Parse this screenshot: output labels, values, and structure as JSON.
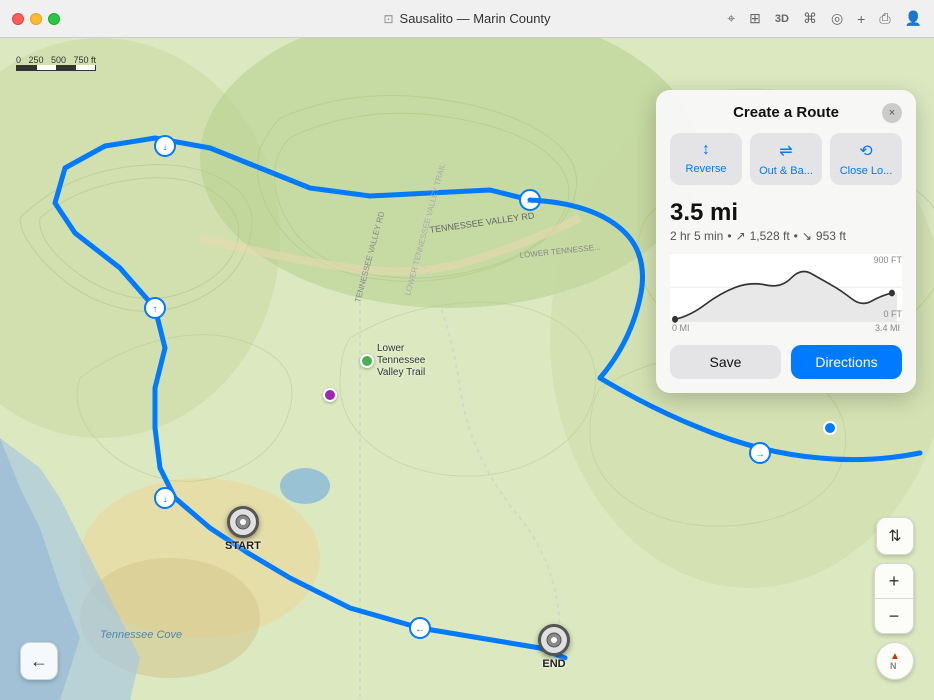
{
  "titleBar": {
    "title": "Sausalito — Marin County",
    "icons": [
      "location-arrow-icon",
      "layers-icon",
      "3d-icon",
      "transit-icon",
      "location-icon",
      "add-icon",
      "share-icon",
      "account-icon"
    ]
  },
  "scale": {
    "labels": [
      "0",
      "250",
      "500",
      "750 ft"
    ]
  },
  "panel": {
    "title": "Create a Route",
    "close_label": "×",
    "actions": [
      {
        "icon": "↕",
        "label": "Reverse"
      },
      {
        "icon": "S",
        "label": "Out & Ba..."
      },
      {
        "icon": "⟲",
        "label": "Close Lo..."
      }
    ],
    "route": {
      "distance": "3.5 mi",
      "time": "2 hr 5 min",
      "elevation_up": "1,528 ft",
      "elevation_down": "953 ft"
    },
    "elevationChart": {
      "yMax": "900 FT",
      "yMin": "0 FT",
      "xMin": "0 MI",
      "xMax": "3.4 MI"
    },
    "saveLabel": "Save",
    "directionsLabel": "Directions"
  },
  "markers": {
    "start": "START",
    "end": "END"
  },
  "mapLabels": {
    "tennessee_valley_rd": "TENNESSEE VALLEY RD",
    "lower_tennessee": "LOWER TENNESSE...",
    "tennessee_valley_trail": "LOWER TENNESSEE VALLEY TRAIL",
    "lower_tv_trail": "LOWER TENNESSEE VALLEY TRAIL",
    "tennessee_cove": "Tennessee Cove",
    "poi_name": "Lower Tennessee Valley Trail"
  },
  "controls": {
    "back_icon": "←",
    "filter_icon": "⇄",
    "zoom_in": "+",
    "zoom_out": "−",
    "compass": "N"
  }
}
